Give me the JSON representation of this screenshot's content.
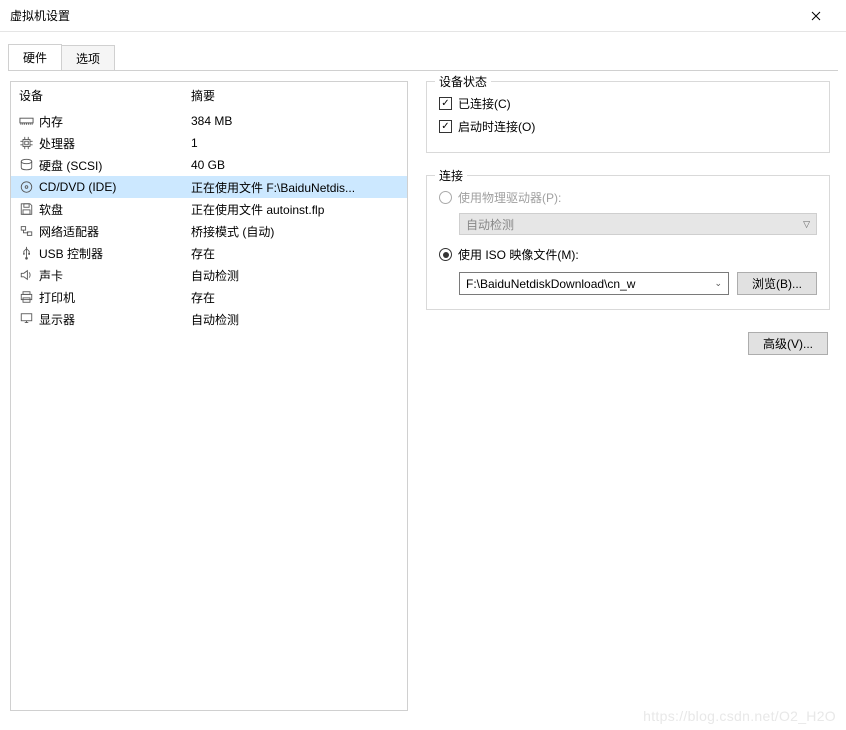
{
  "window": {
    "title": "虚拟机设置"
  },
  "tabs": {
    "hardware": "硬件",
    "options": "选项"
  },
  "listHeader": {
    "device": "设备",
    "summary": "摘要"
  },
  "hardware": [
    {
      "icon": "memory",
      "name": "内存",
      "summary": "384 MB",
      "selected": false
    },
    {
      "icon": "cpu",
      "name": "处理器",
      "summary": "1",
      "selected": false
    },
    {
      "icon": "disk",
      "name": "硬盘 (SCSI)",
      "summary": "40 GB",
      "selected": false
    },
    {
      "icon": "cd",
      "name": "CD/DVD (IDE)",
      "summary": "正在使用文件 F:\\BaiduNetdis...",
      "selected": true
    },
    {
      "icon": "floppy",
      "name": "软盘",
      "summary": "正在使用文件 autoinst.flp",
      "selected": false
    },
    {
      "icon": "network",
      "name": "网络适配器",
      "summary": "桥接模式 (自动)",
      "selected": false
    },
    {
      "icon": "usb",
      "name": "USB 控制器",
      "summary": "存在",
      "selected": false
    },
    {
      "icon": "sound",
      "name": "声卡",
      "summary": "自动检测",
      "selected": false
    },
    {
      "icon": "printer",
      "name": "打印机",
      "summary": "存在",
      "selected": false
    },
    {
      "icon": "display",
      "name": "显示器",
      "summary": "自动检测",
      "selected": false
    }
  ],
  "status": {
    "title": "设备状态",
    "connected": "已连接(C)",
    "connectAtPowerOn": "启动时连接(O)"
  },
  "connection": {
    "title": "连接",
    "usePhysical": "使用物理驱动器(P):",
    "autoDetect": "自动检测",
    "useIso": "使用 ISO 映像文件(M):",
    "isoPath": "F:\\BaiduNetdiskDownload\\cn_w",
    "browse": "浏览(B)..."
  },
  "advanced": "高级(V)...",
  "watermark": "https://blog.csdn.net/O2_H2O"
}
